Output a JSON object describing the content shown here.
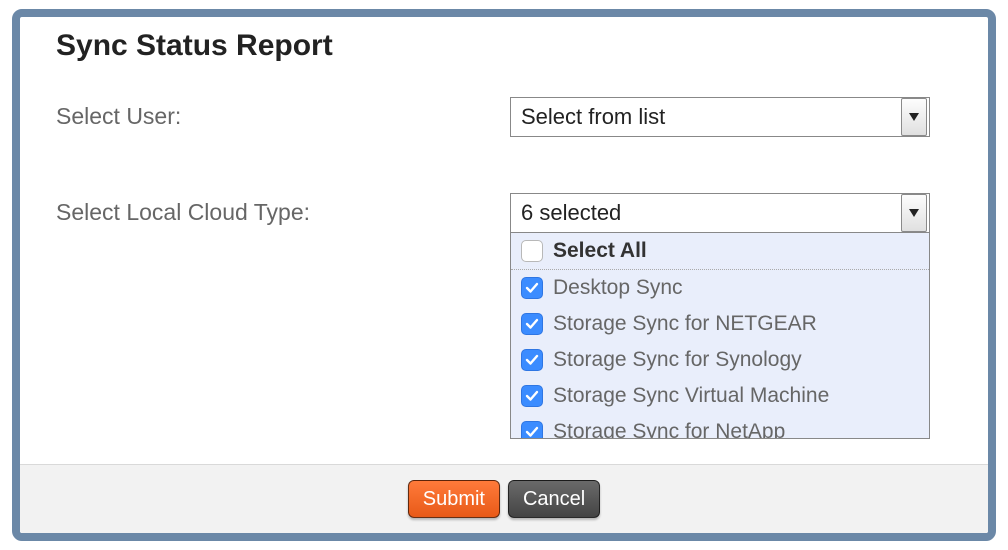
{
  "title": "Sync Status Report",
  "fields": {
    "user": {
      "label": "Select User:",
      "value": "Select from list"
    },
    "cloudType": {
      "label": "Select Local Cloud Type:",
      "summary": "6 selected",
      "selectAllLabel": "Select All",
      "selectAllChecked": false,
      "options": [
        {
          "label": "Desktop Sync",
          "checked": true
        },
        {
          "label": "Storage Sync for NETGEAR",
          "checked": true
        },
        {
          "label": "Storage Sync for Synology",
          "checked": true
        },
        {
          "label": "Storage Sync Virtual Machine",
          "checked": true
        },
        {
          "label": "Storage Sync for NetApp",
          "checked": true
        }
      ]
    }
  },
  "buttons": {
    "submit": "Submit",
    "cancel": "Cancel"
  }
}
